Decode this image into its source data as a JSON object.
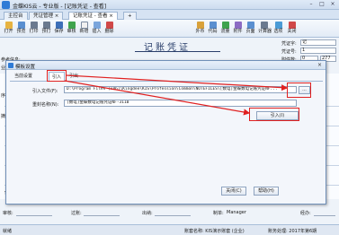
{
  "window": {
    "title": "金蝶KIS云 - 专业版 - [记账凭证 - 查看]",
    "controls": [
      "–",
      "□",
      "×"
    ]
  },
  "tabs": [
    {
      "label": "主控台"
    },
    {
      "label": "凭证管理 ×"
    },
    {
      "label": "记账凭证 - 查看 ×"
    },
    {
      "label": "+"
    }
  ],
  "toolbar": {
    "left": [
      "打开",
      "预览",
      "打印",
      "预打",
      "保存",
      "审核",
      "新增",
      "插入",
      "删除"
    ],
    "right": [
      "外币",
      "代码",
      "流量",
      "附件",
      "页面",
      "计算器",
      "选项",
      "关闭"
    ]
  },
  "voucher": {
    "title": "记账凭证",
    "word_label": "凭证字:",
    "word_value": "记",
    "number_label": "凭证号:",
    "number_value": "1",
    "attach_label": "附件数:",
    "attach_value": "0",
    "page_value": "277",
    "left_labels": [
      "参考信息:",
      "业务日期:"
    ],
    "col_labels": [
      "序号",
      "摘"
    ],
    "total_label": "合计"
  },
  "footer": {
    "review_label": "审核:",
    "post_label": "过账:",
    "cashier_label": "出纳:",
    "maker_label": "制单:",
    "maker_value": "Manager",
    "handler_label": "经办:"
  },
  "statusbar": {
    "left": "就绪",
    "account": "账套名称: KIS演示账套 (企业)",
    "period": "账务处理: 2017年第6期"
  },
  "dialog": {
    "title": "模板设置",
    "tabs": [
      "当前设置",
      "引入",
      "引出"
    ],
    "active_tab": "引入",
    "file_label": "引入文件(F):",
    "file_value": "D:\\Program Files (x86)\\Kingdee\\KIS\\Profession\\Common\\NOTEFILES\\[数电]金蝶数电记账凭证NF...",
    "browse_label": "...",
    "name_label": "重封名称(N):",
    "name_value": "[数电]金蝶数电记账凭证NF-3110",
    "import_label": "引入(I)",
    "close_label": "关闭(C)",
    "help_label": "帮助(H)"
  },
  "colors": {
    "annotation": "#e02020",
    "titlebar": "#dfeaf7",
    "brand": "#2f7bd6"
  }
}
